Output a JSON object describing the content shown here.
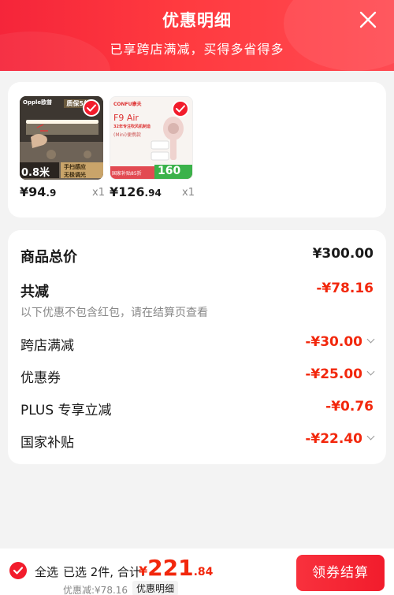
{
  "header": {
    "title": "优惠明细",
    "subtitle": "已享跨店满减，买得多省得多"
  },
  "products": [
    {
      "price_int": "¥94",
      "price_dec": ".9",
      "qty": "x1",
      "thumb_brand": "Opple欧普",
      "thumb_badge": "质保5年",
      "thumb_size": "0.8米",
      "thumb_feature_1": "手扫感应",
      "thumb_feature_2": "无极调光"
    },
    {
      "price_int": "¥126",
      "price_dec": ".94",
      "qty": "x1",
      "thumb_brand": "CONFU康夫",
      "thumb_model": "F9 Air",
      "thumb_tagline": "32年专注吹风机制造",
      "thumb_mini": "(Mini)便携款",
      "thumb_promo": "国家补贴85折",
      "thumb_price": "160"
    }
  ],
  "summary": {
    "total_label": "商品总价",
    "total_value": "¥300.00",
    "reduce_label": "共减",
    "reduce_value": "-¥78.16",
    "note": "以下优惠不包含红包，请在结算页查看",
    "items": [
      {
        "label": "跨店满减",
        "value": "-¥30.00",
        "expandable": true
      },
      {
        "label": "优惠券",
        "value": "-¥25.00",
        "expandable": true
      },
      {
        "label": "PLUS 专享立减",
        "value": "-¥0.76",
        "expandable": false
      },
      {
        "label": "国家补贴",
        "value": "-¥22.40",
        "expandable": true
      }
    ]
  },
  "footer": {
    "select_all": "全选",
    "selected_text": "已选 2件, 合计:",
    "currency": "¥",
    "total_int": "221",
    "total_dec": ".84",
    "discount_text": "优惠减:¥78.16",
    "detail_link": "优惠明细",
    "checkout_button": "领券结算"
  },
  "colors": {
    "accent": "#f21c2c",
    "price_red": "#f2270c",
    "header_start": "#f5253a",
    "header_end": "#ff4a52"
  }
}
